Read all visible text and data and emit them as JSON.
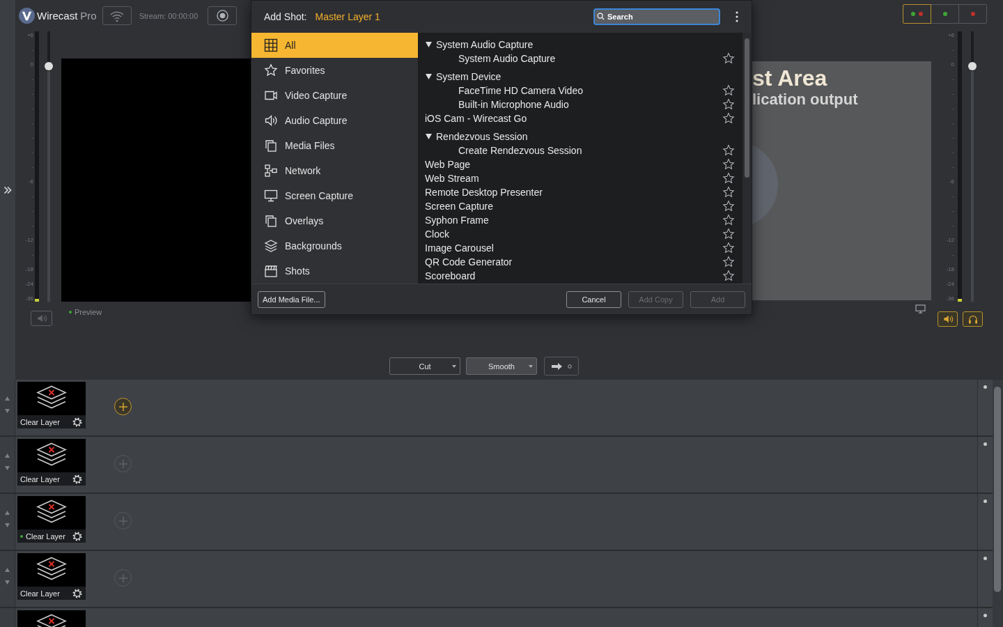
{
  "app": {
    "name": "Wirecast",
    "edition": "Pro",
    "stream": "Stream: 00:00:00"
  },
  "status_buttons": [
    {
      "selected": true,
      "dots": [
        {
          "color": "#3fa535"
        },
        {
          "color": "#c0302b"
        }
      ]
    },
    {
      "selected": false,
      "dots": [
        {
          "color": "#3fa535"
        }
      ]
    },
    {
      "selected": false,
      "dots": [
        {
          "color": "#c0302b"
        }
      ]
    }
  ],
  "left_audio": {
    "scale": [
      "+6",
      "-",
      "0",
      "-",
      "-",
      "-",
      "-",
      "-",
      "-",
      "-",
      "-6",
      "-",
      "-",
      "-",
      "-12",
      "-",
      "-18",
      "-24",
      "-36"
    ],
    "meter": {
      "level": 0.01
    },
    "volume": {
      "level": 0.87
    },
    "speaker": {
      "on": false
    }
  },
  "preview": {
    "label": "Preview",
    "live": true
  },
  "program": {
    "title": "st Area",
    "subtitle": "lication output"
  },
  "right_audio": {
    "scale": [
      "+6",
      "-",
      "0",
      "-",
      "-",
      "-",
      "-",
      "-",
      "-",
      "-",
      "-6",
      "-",
      "-",
      "-",
      "-12",
      "-",
      "-18",
      "-24",
      "-36"
    ],
    "meter": {
      "level": 0.01
    },
    "volume": {
      "level": 0.87
    },
    "speaker": {
      "on": true
    },
    "headphones": {
      "on": true
    }
  },
  "transitions": [
    {
      "label": "Cut",
      "selected": false
    },
    {
      "label": "Smooth",
      "selected": true
    }
  ],
  "dialog": {
    "title": "Add Shot:",
    "layer": "Master Layer 1",
    "search": {
      "placeholder": "Search"
    },
    "categories": [
      {
        "label": "All",
        "selected": true
      },
      {
        "label": "Favorites",
        "selected": false
      },
      {
        "label": "Video Capture",
        "selected": false
      },
      {
        "label": "Audio Capture",
        "selected": false
      },
      {
        "label": "Media Files",
        "selected": false
      },
      {
        "label": "Network",
        "selected": false
      },
      {
        "label": "Screen Capture",
        "selected": false
      },
      {
        "label": "Overlays",
        "selected": false
      },
      {
        "label": "Backgrounds",
        "selected": false
      },
      {
        "label": "Shots",
        "selected": false
      }
    ],
    "sources": [
      {
        "kind": "group",
        "label": "System Audio Capture",
        "expanded": true,
        "children": [
          {
            "label": "System Audio Capture",
            "favorite": false
          }
        ]
      },
      {
        "kind": "group",
        "label": "System Device",
        "expanded": true,
        "children": [
          {
            "label": "FaceTime HD Camera Video",
            "favorite": false
          },
          {
            "label": "Built-in Microphone Audio",
            "favorite": false
          }
        ]
      },
      {
        "kind": "item",
        "label": "iOS Cam - Wirecast Go",
        "favorite": false
      },
      {
        "kind": "group",
        "label": "Rendezvous Session",
        "expanded": true,
        "children": [
          {
            "label": "Create Rendezvous Session",
            "favorite": false
          }
        ]
      },
      {
        "kind": "item",
        "label": "Web Page",
        "favorite": false
      },
      {
        "kind": "item",
        "label": "Web Stream",
        "favorite": false
      },
      {
        "kind": "item",
        "label": "Remote Desktop Presenter",
        "favorite": false
      },
      {
        "kind": "item",
        "label": "Screen Capture",
        "favorite": false
      },
      {
        "kind": "item",
        "label": "Syphon Frame",
        "favorite": false
      },
      {
        "kind": "item",
        "label": "Clock",
        "favorite": false
      },
      {
        "kind": "item",
        "label": "Image Carousel",
        "favorite": false
      },
      {
        "kind": "item",
        "label": "QR Code Generator",
        "favorite": false
      },
      {
        "kind": "item",
        "label": "Scoreboard",
        "favorite": false
      }
    ],
    "buttons": [
      {
        "label": "Add Media File...",
        "disabled": false
      },
      {
        "label": "Cancel",
        "disabled": false
      },
      {
        "label": "Add Copy",
        "disabled": true
      },
      {
        "label": "Add",
        "disabled": true
      }
    ]
  },
  "layers": [
    {
      "kind": "clear",
      "label": "Clear Layer",
      "live": false,
      "active": true
    },
    {
      "kind": "clear",
      "label": "Clear Layer",
      "live": false,
      "active": false
    },
    {
      "kind": "clear",
      "label": "Clear Layer",
      "live": true,
      "active": false
    },
    {
      "kind": "clear",
      "label": "Clear Layer",
      "live": false,
      "active": false
    },
    {
      "kind": "clear"
    }
  ]
}
